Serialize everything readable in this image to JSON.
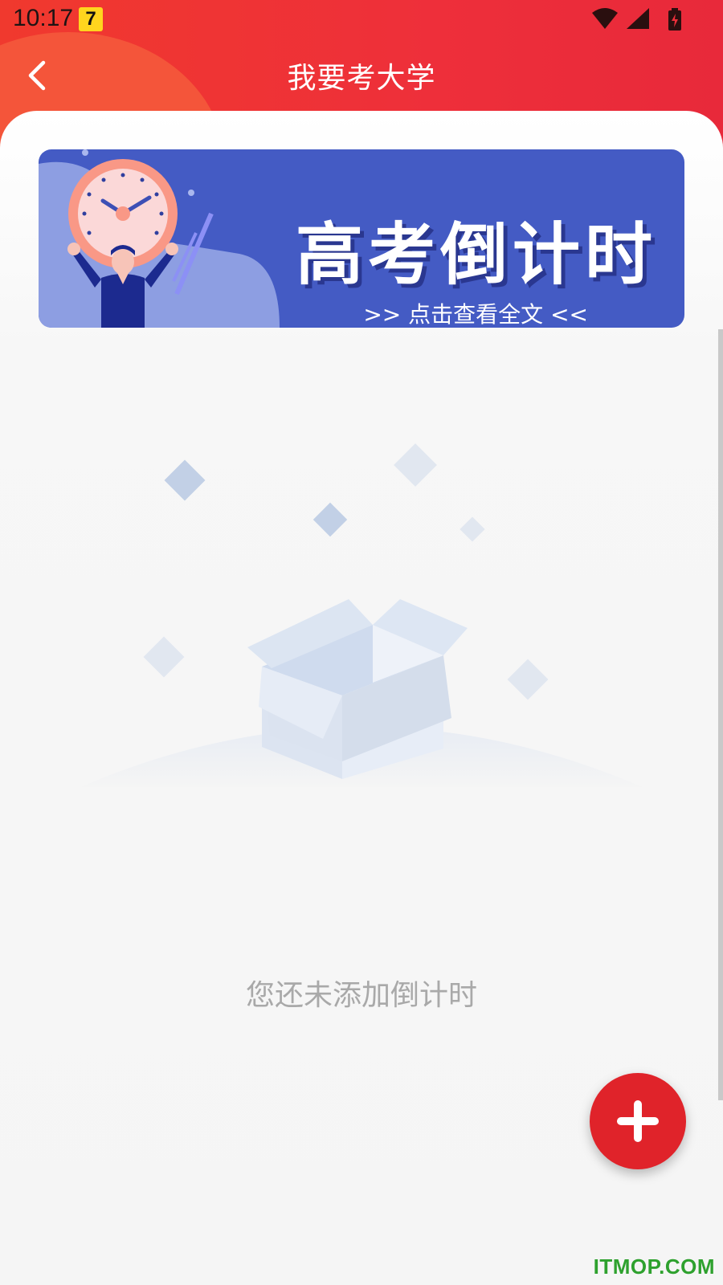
{
  "status_bar": {
    "time": "10:17",
    "app_icon": "7"
  },
  "header": {
    "title": "我要考大学",
    "back_icon": "chevron-left-icon",
    "background_color": "#ee2f3a"
  },
  "banner": {
    "title": "高考倒计时",
    "link_text": ">> 点击查看全文 <<",
    "background_color": "#445bc4"
  },
  "empty_state": {
    "message": "您还未添加倒计时",
    "illustration": "open-box-icon"
  },
  "fab": {
    "icon": "plus-icon",
    "color": "#e0232a"
  },
  "watermark": "ITMOP.COM"
}
